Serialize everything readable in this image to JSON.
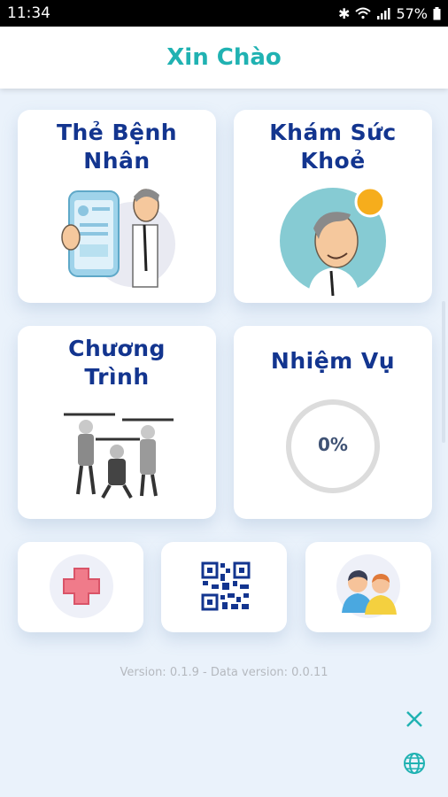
{
  "status": {
    "time": "11:34",
    "battery": "57%"
  },
  "header": {
    "title": "Xin Chào"
  },
  "cards": [
    {
      "title_line1": "Thẻ Bệnh",
      "title_line2": "Nhân"
    },
    {
      "title_line1": "Khám Sức",
      "title_line2": "Khoẻ"
    },
    {
      "title_line1": "Chương",
      "title_line2": "Trình"
    },
    {
      "title_line1": "Nhiệm Vụ",
      "progress": "0%"
    }
  ],
  "small_buttons": [
    {
      "icon": "red-cross-icon"
    },
    {
      "icon": "qr-code-icon"
    },
    {
      "icon": "people-icon"
    }
  ],
  "footer": {
    "version": "Version: 0.1.9 - Data version: 0.0.11"
  },
  "colors": {
    "accent": "#20b2b2",
    "title": "#13358f",
    "background": "#eaf2fb"
  }
}
